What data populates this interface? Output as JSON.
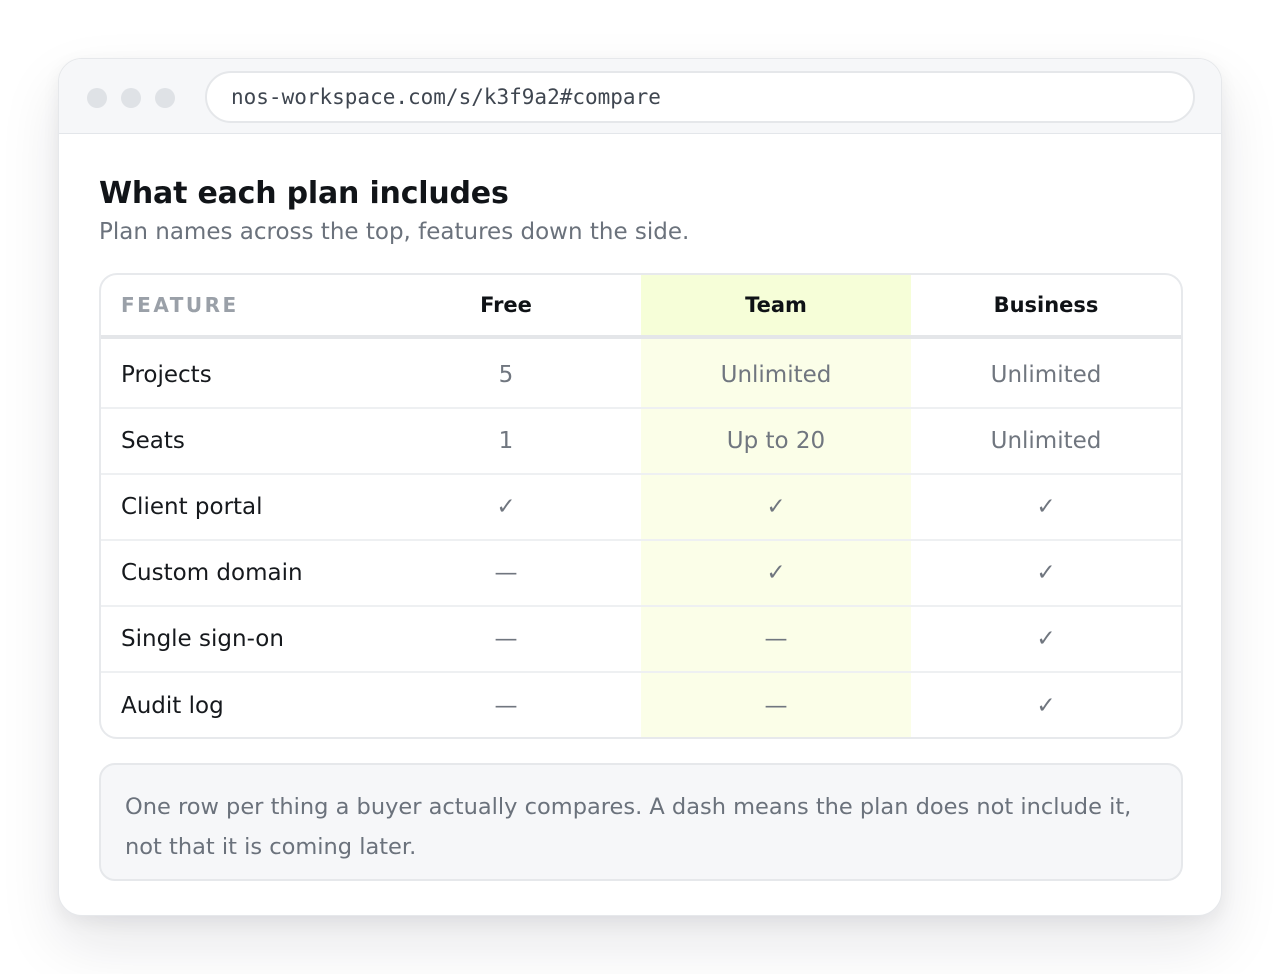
{
  "browser": {
    "url": "nos-workspace.com/s/k3f9a2#compare"
  },
  "page": {
    "title": "What each plan includes",
    "subtitle": "Plan names across the top, features down the side."
  },
  "table": {
    "headers": {
      "feature": "FEATURE",
      "free": "Free",
      "team": "Team",
      "business": "Business"
    },
    "highlight_color": "#f6fed8",
    "rows": [
      {
        "feature": "Projects",
        "free": "5",
        "team": "Unlimited",
        "business": "Unlimited"
      },
      {
        "feature": "Seats",
        "free": "1",
        "team": "Up to 20",
        "business": "Unlimited"
      },
      {
        "feature": "Client portal",
        "free": "✓",
        "team": "✓",
        "business": "✓"
      },
      {
        "feature": "Custom domain",
        "free": "—",
        "team": "✓",
        "business": "✓"
      },
      {
        "feature": "Single sign-on",
        "free": "—",
        "team": "—",
        "business": "✓"
      },
      {
        "feature": "Audit log",
        "free": "—",
        "team": "—",
        "business": "✓"
      }
    ]
  },
  "note": {
    "text": "One row per thing a buyer actually compares. A dash means the plan does not include it, not that it is coming later."
  }
}
